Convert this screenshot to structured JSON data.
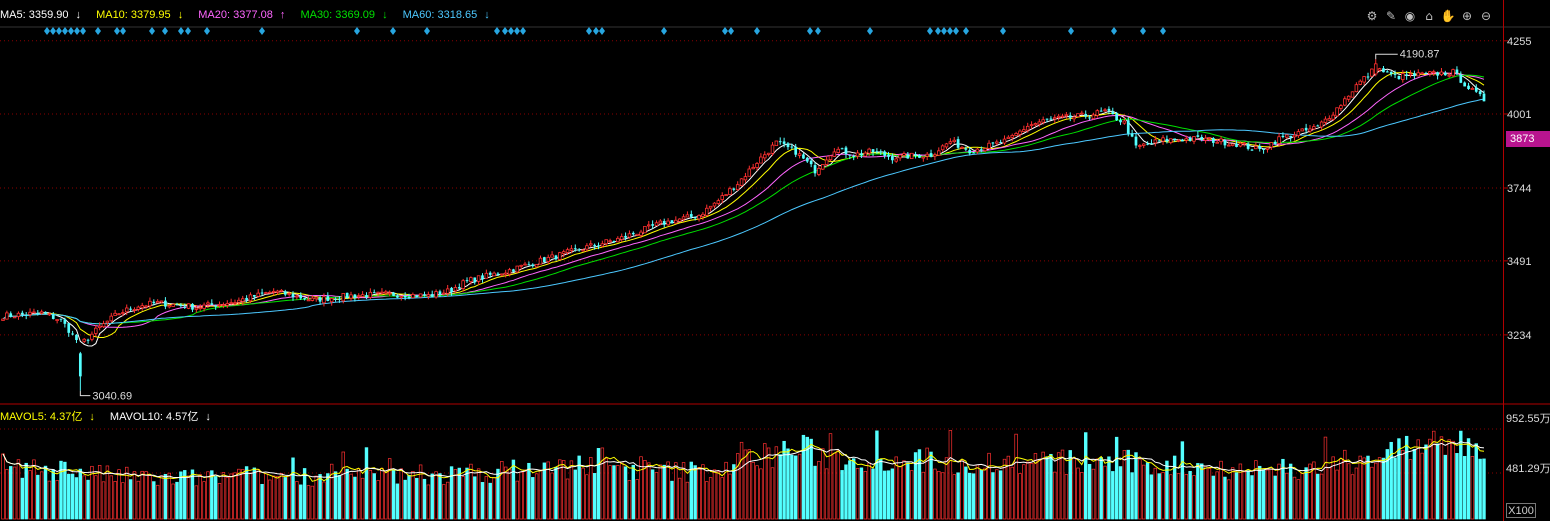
{
  "legend": {
    "ma5": {
      "label": "MA5: 3359.90",
      "arrow": "↓",
      "color": "#ffffff"
    },
    "ma10": {
      "label": "MA10: 3379.95",
      "arrow": "↓",
      "color": "#ffff00"
    },
    "ma20": {
      "label": "MA20: 3377.08",
      "arrow": "↑",
      "color": "#ff66ff"
    },
    "ma30": {
      "label": "MA30: 3369.09",
      "arrow": "↓",
      "color": "#00e000"
    },
    "ma60": {
      "label": "MA60: 3318.65",
      "arrow": "↓",
      "color": "#4cc8ff"
    }
  },
  "volume_legend": {
    "mavol5": {
      "label": "MAVOL5: 4.37亿",
      "arrow": "↓",
      "color": "#ffff00"
    },
    "mavol10": {
      "label": "MAVOL10: 4.57亿",
      "arrow": "↓",
      "color": "#ffffff"
    }
  },
  "toolbar": {
    "icons": [
      "gear-icon",
      "pen-icon",
      "eye-icon",
      "house-icon",
      "hand-icon",
      "zoom-in-icon",
      "zoom-out-icon"
    ],
    "glyphs": [
      "⚙",
      "✎",
      "◉",
      "⌂",
      "✋",
      "⊕",
      "⊖"
    ]
  },
  "current_price_tag": "3873",
  "volume_unit_button": "X100",
  "colors": {
    "up": "#ff3030",
    "down": "#54ffff",
    "grid": "#8a0000",
    "axis": "#b00000",
    "axis_text": "#dcdcdc",
    "signal_marker": "#27a6e0"
  },
  "chart_data": {
    "type": "candlestick",
    "price_axis": {
      "ticks": [
        "4255",
        "4001",
        "3744",
        "3491",
        "3234"
      ],
      "ylim": [
        3001,
        4296
      ]
    },
    "volume_axis": {
      "ticks": [
        "952.55万",
        "481.29万"
      ],
      "ylim": [
        0,
        1060
      ]
    },
    "annotations": {
      "high": "4190.87",
      "low": "3040.69"
    },
    "series": [
      {
        "name": "MA5",
        "color": "#ffffff"
      },
      {
        "name": "MA10",
        "color": "#ffff00"
      },
      {
        "name": "MA20",
        "color": "#ff66ff"
      },
      {
        "name": "MA30",
        "color": "#00e000"
      },
      {
        "name": "MA60",
        "color": "#4cc8ff"
      }
    ],
    "anchors": [
      [
        0,
        3300
      ],
      [
        10,
        3310
      ],
      [
        15,
        3285
      ],
      [
        20,
        3200
      ],
      [
        25,
        3260
      ],
      [
        30,
        3310
      ],
      [
        35,
        3335
      ],
      [
        40,
        3345
      ],
      [
        50,
        3330
      ],
      [
        60,
        3350
      ],
      [
        70,
        3385
      ],
      [
        75,
        3370
      ],
      [
        80,
        3355
      ],
      [
        90,
        3370
      ],
      [
        100,
        3375
      ],
      [
        110,
        3370
      ],
      [
        115,
        3385
      ],
      [
        120,
        3420
      ],
      [
        130,
        3455
      ],
      [
        140,
        3495
      ],
      [
        150,
        3535
      ],
      [
        160,
        3570
      ],
      [
        170,
        3620
      ],
      [
        180,
        3650
      ],
      [
        185,
        3700
      ],
      [
        190,
        3760
      ],
      [
        195,
        3835
      ],
      [
        200,
        3900
      ],
      [
        205,
        3870
      ],
      [
        210,
        3805
      ],
      [
        215,
        3880
      ],
      [
        220,
        3860
      ],
      [
        225,
        3870
      ],
      [
        230,
        3850
      ],
      [
        240,
        3860
      ],
      [
        245,
        3905
      ],
      [
        250,
        3875
      ],
      [
        255,
        3890
      ],
      [
        260,
        3910
      ],
      [
        265,
        3960
      ],
      [
        270,
        3980
      ],
      [
        280,
        3995
      ],
      [
        285,
        4010
      ],
      [
        290,
        3970
      ],
      [
        293,
        3885
      ],
      [
        300,
        3910
      ],
      [
        310,
        3915
      ],
      [
        320,
        3895
      ],
      [
        325,
        3875
      ],
      [
        330,
        3915
      ],
      [
        340,
        3955
      ],
      [
        345,
        4020
      ],
      [
        350,
        4100
      ],
      [
        355,
        4160
      ],
      [
        360,
        4130
      ],
      [
        370,
        4140
      ],
      [
        375,
        4145
      ],
      [
        380,
        4080
      ],
      [
        383,
        4050
      ]
    ],
    "volume_anchors": [
      [
        0,
        420
      ],
      [
        15,
        500
      ],
      [
        20,
        470
      ],
      [
        25,
        440
      ],
      [
        40,
        400
      ],
      [
        80,
        430
      ],
      [
        110,
        420
      ],
      [
        120,
        450
      ],
      [
        130,
        480
      ],
      [
        150,
        520
      ],
      [
        160,
        500
      ],
      [
        175,
        470
      ],
      [
        185,
        490
      ],
      [
        195,
        620
      ],
      [
        205,
        700
      ],
      [
        215,
        610
      ],
      [
        230,
        600
      ],
      [
        240,
        580
      ],
      [
        255,
        560
      ],
      [
        270,
        570
      ],
      [
        290,
        560
      ],
      [
        300,
        530
      ],
      [
        320,
        510
      ],
      [
        330,
        480
      ],
      [
        340,
        500
      ],
      [
        350,
        580
      ],
      [
        360,
        680
      ],
      [
        370,
        710
      ],
      [
        375,
        760
      ],
      [
        383,
        700
      ]
    ],
    "signal_marker_count": 45
  }
}
